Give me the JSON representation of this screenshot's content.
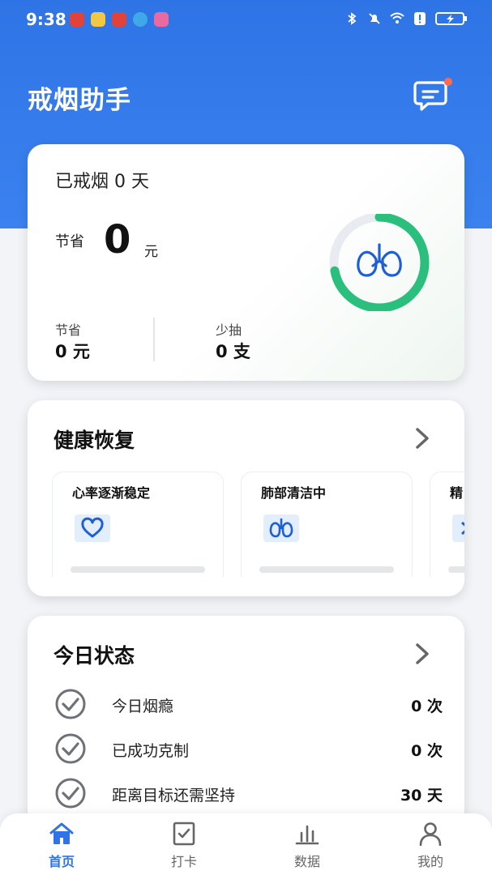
{
  "status_bar": {
    "time": "9:38",
    "notification_icons": [
      {
        "icon": "huawei-app-icon",
        "color": "#e0433a"
      },
      {
        "icon": "bulb-app-icon",
        "color": "#f2c744"
      },
      {
        "icon": "huawei-app-icon",
        "color": "#e0433a"
      },
      {
        "icon": "globe-app-icon",
        "color": "#3fa9e8"
      },
      {
        "icon": "gallery-app-icon",
        "color": "#e86aa0"
      }
    ],
    "system_icons": [
      "bluetooth-icon",
      "mute-icon",
      "wifi-icon",
      "alert-icon",
      "battery-charging-icon"
    ]
  },
  "header": {
    "title": "戒烟助手",
    "message_icon": "chat-message-icon",
    "badge_color": "#ff6a4d"
  },
  "summary": {
    "days_text": "已戒烟 0 天",
    "saved_label": "节省",
    "saved_value": "0",
    "saved_unit": "元",
    "progress_icon": "lungs-icon",
    "progress_fraction": 0.72,
    "stats": [
      {
        "label": "节省",
        "value": "0 元"
      },
      {
        "label": "少抽",
        "value": "0 支"
      }
    ]
  },
  "health": {
    "title": "健康恢复",
    "items": [
      {
        "title": "心率逐渐稳定",
        "icon": "heart-icon"
      },
      {
        "title": "肺部清洁中",
        "icon": "lungs-icon"
      },
      {
        "title": "精",
        "icon": "spark-icon"
      }
    ]
  },
  "today": {
    "title": "今日状态",
    "rows": [
      {
        "label": "今日烟瘾",
        "value": "0 次"
      },
      {
        "label": "已成功克制",
        "value": "0 次"
      },
      {
        "label": "距离目标还需坚持",
        "value": "30 天"
      }
    ]
  },
  "nav": {
    "items": [
      {
        "label": "首页",
        "icon": "home-icon",
        "active": true
      },
      {
        "label": "打卡",
        "icon": "checkin-icon",
        "active": false
      },
      {
        "label": "数据",
        "icon": "chart-icon",
        "active": false
      },
      {
        "label": "我的",
        "icon": "profile-icon",
        "active": false
      }
    ]
  },
  "colors": {
    "primary": "#2f74e6",
    "ring_green": "#2bbf7d",
    "ring_track": "#e8ebf0",
    "icon_blue": "#1f5fd6"
  }
}
